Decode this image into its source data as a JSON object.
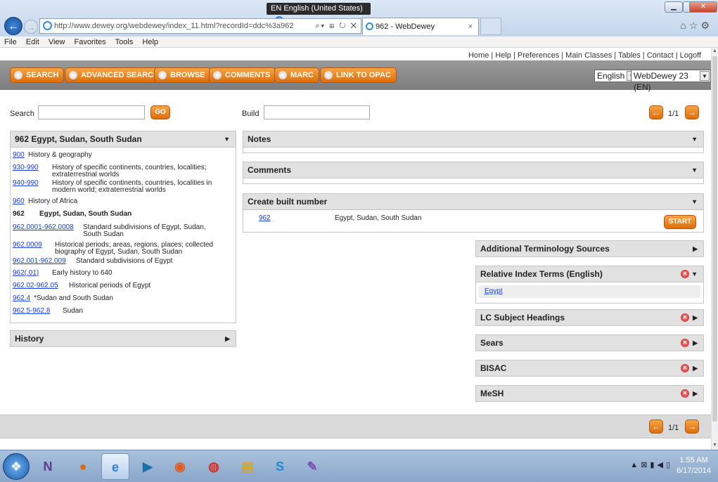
{
  "browser": {
    "ime_indicator": "EN English (United States)",
    "ime_help": "Help",
    "address": "http://www.dewey.org/webdewey/index_11.html?recordId=ddc%3a962",
    "address_host_bold": "dewey.org",
    "tab_title": "962 - WebDewey",
    "menu": [
      "File",
      "Edit",
      "View",
      "Favorites",
      "Tools",
      "Help"
    ]
  },
  "header": {
    "links": "Home | Help | Preferences | Main Classes | Tables | Contact | Logoff",
    "buttons": [
      "SEARCH",
      "ADVANCED SEARCH",
      "BROWSE",
      "COMMENTS",
      "MARC",
      "LINK TO OPAC"
    ],
    "language_select": "English",
    "edition_select": "WebDewey 23 (EN)"
  },
  "search": {
    "label": "Search",
    "value": "",
    "go": "GO",
    "build_label": "Build",
    "build_value": ""
  },
  "pager": {
    "text": "1/1"
  },
  "left_panel": {
    "title": "962 Egypt, Sudan, South Sudan",
    "rows": [
      {
        "code": "900",
        "desc": "History & geography",
        "link": true
      },
      {
        "code": "930-990",
        "desc": "History of specific continents, countries, localities; extraterrestrial worlds",
        "link": true
      },
      {
        "code": "940-990",
        "desc": "History of specific continents, countries, localities in modern world; extraterrestrial worlds",
        "link": true
      },
      {
        "code": "960",
        "desc": "History of Africa",
        "link": true
      },
      {
        "code": "962",
        "desc": "Egypt, Sudan, South Sudan",
        "link": false
      },
      {
        "code": "962.0001-962.0008",
        "desc": "Standard subdivisions of Egypt, Sudan, South Sudan",
        "link": true
      },
      {
        "code": "962.0009",
        "desc": "Historical periods; areas, regions, places; collected biography of Egypt, Sudan, South Sudan",
        "link": true
      },
      {
        "code": "962.001-962.009",
        "desc": "Standard subdivisions of Egypt",
        "link": true
      },
      {
        "code": "962(.01)",
        "desc": "Early history to 640",
        "link": true
      },
      {
        "code": "962.02-962.05",
        "desc": "Historical periods of Egypt",
        "link": true
      },
      {
        "code": "962.4",
        "desc": "*Sudan and South Sudan",
        "link": true
      },
      {
        "code": "962.5-962.8",
        "desc": "Sudan",
        "link": true
      }
    ],
    "history_title": "History"
  },
  "right_panels": {
    "notes": "Notes",
    "comments": "Comments",
    "create_built": "Create built number",
    "built_row": {
      "code": "962",
      "desc": "Egypt, Sudan, South Sudan",
      "start": "START"
    },
    "additional_terms": "Additional Terminology Sources",
    "relative_index": "Relative Index Terms (English)",
    "relative_index_item": "Egypt",
    "lc_subject": "LC Subject Headings",
    "sears": "Sears",
    "bisac": "BISAC",
    "mesh": "MeSH"
  },
  "taskbar": {
    "time": "1:55 AM",
    "date": "6/17/2014"
  }
}
